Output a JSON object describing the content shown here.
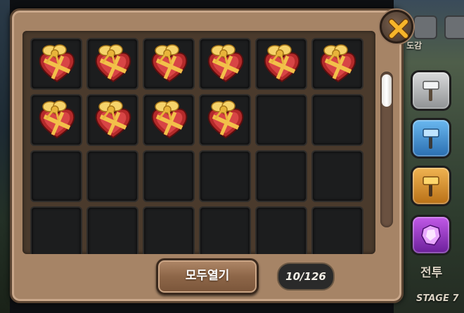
{
  "background": {
    "top_label_fragment": "도감",
    "battle_label": "전투",
    "stage_label": "STAGE 7"
  },
  "inventory": {
    "columns": 6,
    "visible_rows": 4,
    "filled_slots": 10,
    "item_icon": "heart-gift-box-icon"
  },
  "footer": {
    "open_all_label": "모두열기",
    "count_label": "10/126"
  },
  "close_icon": "close-x-icon",
  "side_tools": [
    {
      "name": "silver-hammer-icon",
      "color": "#b9bcbf"
    },
    {
      "name": "blue-hammer-icon",
      "color": "#3f8fd6"
    },
    {
      "name": "gold-hammer-icon",
      "color": "#d79a2b"
    },
    {
      "name": "purple-crystal-icon",
      "color": "#a23fd0"
    }
  ]
}
